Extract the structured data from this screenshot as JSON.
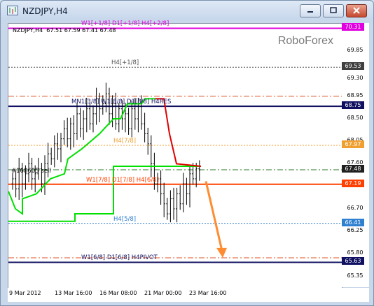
{
  "window": {
    "title": "NZDJPY,H4"
  },
  "chart": {
    "info_line": "NZDJPY,H4  67.51 67.59 67.41 67.48",
    "watermark": "RoboForex",
    "side_label": "#168605 sell",
    "colors": {
      "background": "#ffffff",
      "bars": "#000000",
      "green_line": "#00e000",
      "red_line": "#e00000",
      "arrow": "#ff8c30"
    },
    "levels": [
      {
        "price": 70.31,
        "label": "W1[+1/8] D1[+1/8] H4[+2/8]",
        "color": "#e000e0",
        "style": "solid",
        "tag": "70.31",
        "tag_color": "#e000e0"
      },
      {
        "price": 69.53,
        "label": "H4[+1/8]",
        "color": "#505050",
        "style": "dotted",
        "tag": "69.53",
        "tag_color": "#404040"
      },
      {
        "price": 68.95,
        "label": "",
        "color": "#e05020",
        "style": "dashdot",
        "tag": "",
        "tag_color": ""
      },
      {
        "price": 68.75,
        "label": "MN1[3/8] W1[8/8] D1[8/8] H4RES",
        "color": "#101060",
        "style": "solid",
        "tag": "68.75",
        "tag_color": "#101060"
      },
      {
        "price": 67.97,
        "label": "H4[7/8]",
        "color": "#f0a030",
        "style": "dotted",
        "tag": "67.97",
        "tag_color": "#f0a030"
      },
      {
        "price": 67.48,
        "label": "",
        "color": "#2a7a2a",
        "style": "dashdot",
        "tag": "67.48",
        "tag_color": "#202020"
      },
      {
        "price": 67.19,
        "label": "W1[7/8] D1[7/8] H4[6/8]",
        "color": "#ff4000",
        "style": "solid",
        "tag": "67.19",
        "tag_color": "#ff4000"
      },
      {
        "price": 66.41,
        "label": "H4[5/8]",
        "color": "#3080d0",
        "style": "dotted",
        "tag": "66.41",
        "tag_color": "#3080d0"
      },
      {
        "price": 65.72,
        "label": "",
        "color": "#e05020",
        "style": "dashdot",
        "tag": "",
        "tag_color": ""
      },
      {
        "price": 65.63,
        "label": "W1[6/8] D1[6/8] H4PIVOT",
        "color": "#101060",
        "style": "solid",
        "tag": "65.63",
        "tag_color": "#101060"
      }
    ],
    "price_ticks": [
      "69.85",
      "69.30",
      "68.95",
      "68.50",
      "68.05",
      "67.60",
      "67.15",
      "66.70",
      "66.25",
      "65.80",
      "65.35"
    ],
    "time_ticks": [
      "9 Mar 2012",
      "13 Mar 16:00",
      "16 Mar 08:00",
      "21 Mar 00:00",
      "23 Mar 16:00"
    ],
    "y_range": [
      65.12,
      70.4
    ]
  }
}
